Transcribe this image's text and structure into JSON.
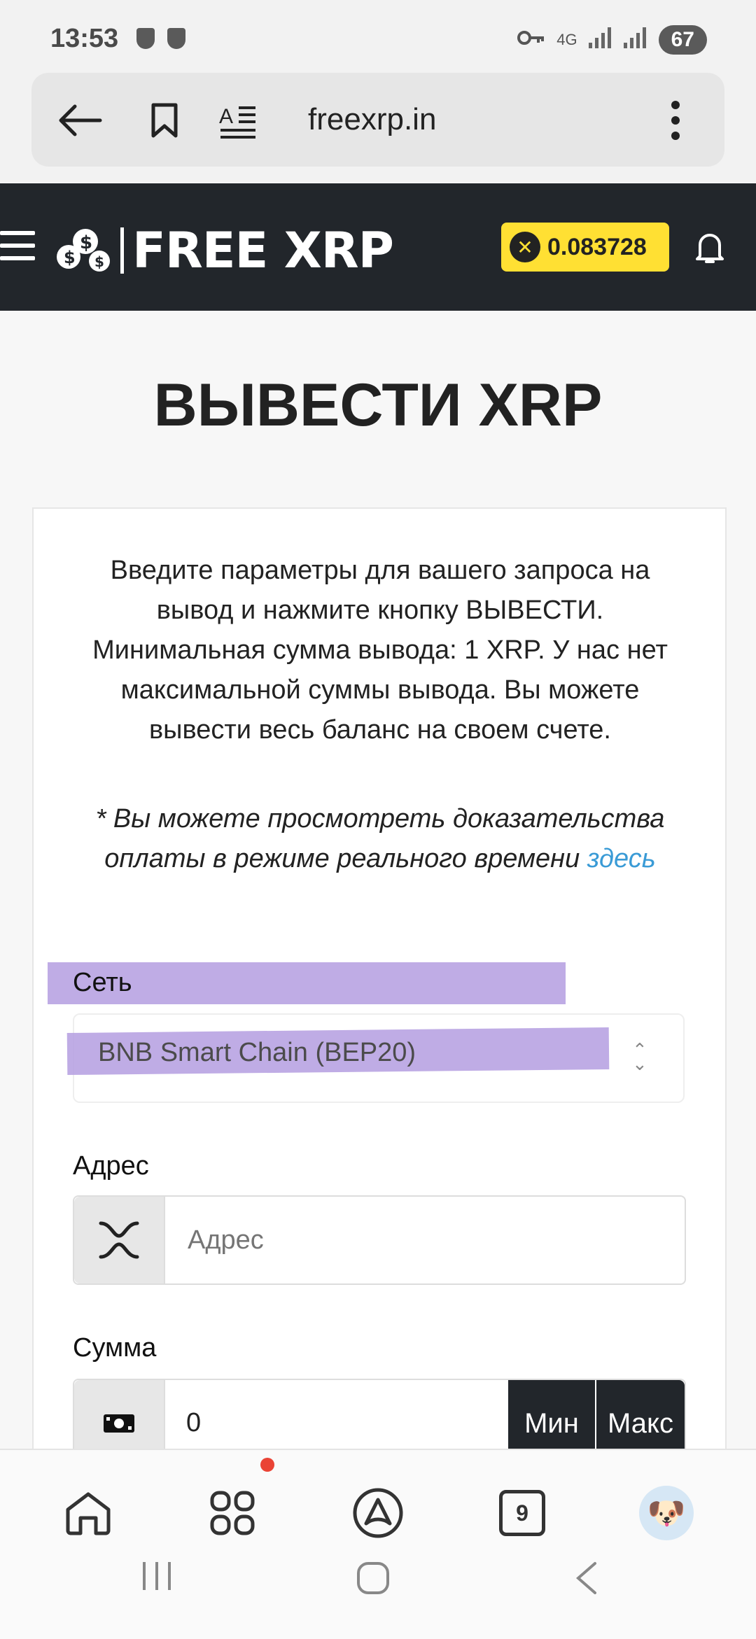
{
  "status_bar": {
    "time": "13:53",
    "network": "4G",
    "battery": "67"
  },
  "browser": {
    "url": "freexrp.in"
  },
  "site": {
    "logo_text": "FREE XRP",
    "balance": "0.083728"
  },
  "page": {
    "title": "ВЫВЕСТИ XRP",
    "description": "Введите параметры для вашего запроса на вывод и нажмите кнопку ВЫВЕСТИ. Минимальная сумма вывода: 1 XRP. У нас нет максимальной суммы вывода. Вы можете вывести весь баланс на своем счете.",
    "note_prefix": "* Вы можете просмотреть доказательства оплаты в режиме реального времени ",
    "note_link": "здесь"
  },
  "form": {
    "network_label": "Сеть",
    "network_value": "BNB Smart Chain (BEP20)",
    "address_label": "Адрес",
    "address_placeholder": "Адрес",
    "amount_label": "Сумма",
    "amount_value": "0",
    "min_label": "Мин",
    "max_label": "Макс"
  },
  "bottom_nav": {
    "tab_count": "9"
  }
}
